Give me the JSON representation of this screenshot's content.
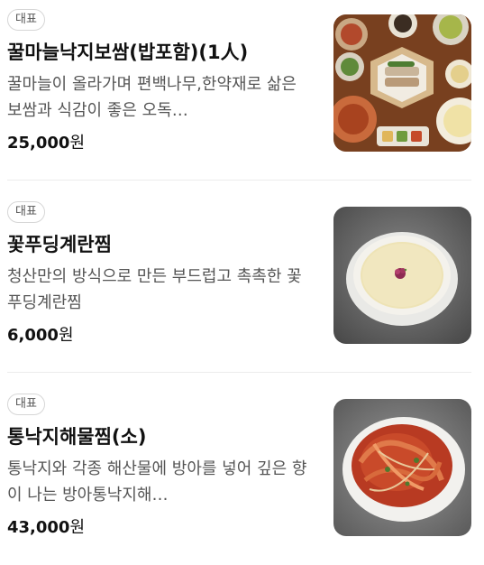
{
  "menu": {
    "items": [
      {
        "badge": "대표",
        "title": "꿀마늘낙지보쌈(밥포함)(1人)",
        "description": "꿀마늘이 올라가며 편백나무,한약재로 삶은 보쌈과 식감이 좋은 오독…",
        "price": "25,000",
        "currency": "원",
        "photo": "bossam-platter-photo"
      },
      {
        "badge": "대표",
        "title": "꽃푸딩계란찜",
        "description": "청산만의 방식으로 만든 부드럽고 촉촉한 꽃푸딩계란찜",
        "price": "6,000",
        "currency": "원",
        "photo": "egg-pudding-photo"
      },
      {
        "badge": "대표",
        "title": "통낙지해물찜(소)",
        "description": "통낙지와 각종 해산물에 방아를 넣어 깊은 향이 나는 방아통낙지해…",
        "price": "43,000",
        "currency": "원",
        "photo": "seafood-jjim-photo"
      }
    ]
  },
  "colors": {
    "text": "#111111",
    "description": "#555555",
    "badge_border": "#d6d6d6",
    "divider": "#ececec"
  }
}
